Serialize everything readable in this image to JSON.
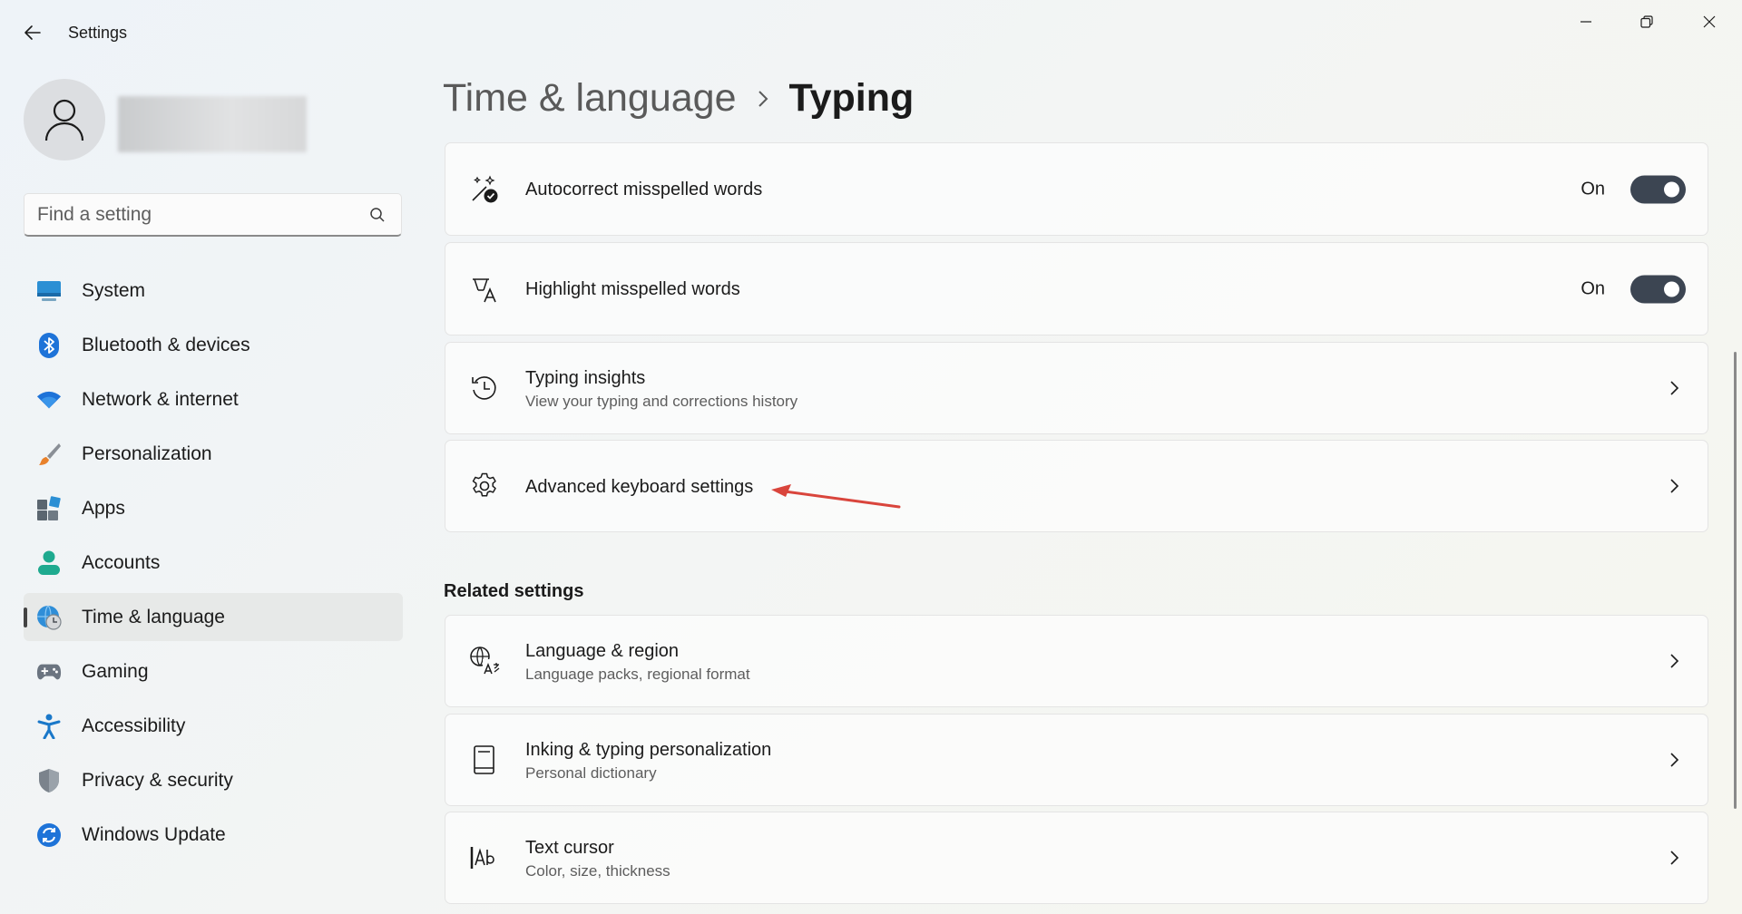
{
  "window": {
    "title": "Settings",
    "back_icon": "back-arrow-icon",
    "controls": [
      "minimize-icon",
      "restore-icon",
      "close-icon"
    ]
  },
  "sidebar": {
    "search": {
      "placeholder": "Find a setting",
      "value": "",
      "icon": "search-icon"
    },
    "items": [
      {
        "label": "System",
        "icon": "system-icon",
        "active": false
      },
      {
        "label": "Bluetooth & devices",
        "icon": "bluetooth-icon",
        "active": false
      },
      {
        "label": "Network & internet",
        "icon": "wifi-icon",
        "active": false
      },
      {
        "label": "Personalization",
        "icon": "brush-icon",
        "active": false
      },
      {
        "label": "Apps",
        "icon": "apps-icon",
        "active": false
      },
      {
        "label": "Accounts",
        "icon": "accounts-icon",
        "active": false
      },
      {
        "label": "Time & language",
        "icon": "globe-clock-icon",
        "active": true
      },
      {
        "label": "Gaming",
        "icon": "gamepad-icon",
        "active": false
      },
      {
        "label": "Accessibility",
        "icon": "accessibility-icon",
        "active": false
      },
      {
        "label": "Privacy & security",
        "icon": "shield-icon",
        "active": false
      },
      {
        "label": "Windows Update",
        "icon": "update-icon",
        "active": false
      }
    ]
  },
  "breadcrumb": {
    "parent": "Time & language",
    "current": "Typing"
  },
  "settings": {
    "autocorrect": {
      "title": "Autocorrect misspelled words",
      "state_label": "On",
      "enabled": true
    },
    "highlight": {
      "title": "Highlight misspelled words",
      "state_label": "On",
      "enabled": true
    },
    "insights": {
      "title": "Typing insights",
      "subtitle": "View your typing and corrections history"
    },
    "advanced": {
      "title": "Advanced keyboard settings"
    }
  },
  "related": {
    "heading": "Related settings",
    "items": [
      {
        "title": "Language & region",
        "subtitle": "Language packs, regional format"
      },
      {
        "title": "Inking & typing personalization",
        "subtitle": "Personal dictionary"
      },
      {
        "title": "Text cursor",
        "subtitle": "Color, size, thickness"
      }
    ]
  },
  "colors": {
    "accent": "#3c4552",
    "annotation": "#d9453c"
  }
}
